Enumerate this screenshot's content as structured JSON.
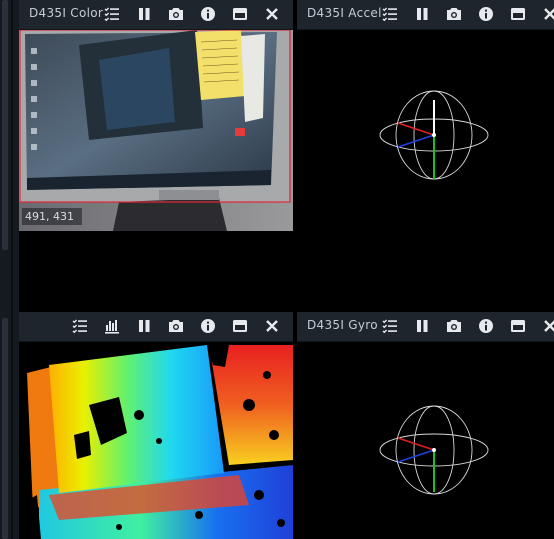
{
  "panels": {
    "color": {
      "title": "D435I Color",
      "pixel_readout": "491, 431"
    },
    "accel": {
      "title": "D435I Accel"
    },
    "depth": {
      "title": ""
    },
    "gyro": {
      "title": "D435I Gyro"
    }
  },
  "icons": {
    "controls": "controls-icon",
    "histogram": "histogram-icon",
    "pause": "pause-icon",
    "snapshot": "camera-icon",
    "info": "info-icon",
    "maximize": "maximize-icon",
    "close": "close-icon"
  },
  "colors": {
    "toolbar_bg": "#1f252c",
    "title_text": "#c4ccd4",
    "icon": "#e6eaee",
    "roi_outline": "#e0283a",
    "axis_x": "#e02020",
    "axis_y": "#20c020",
    "axis_z": "#2040e0"
  }
}
